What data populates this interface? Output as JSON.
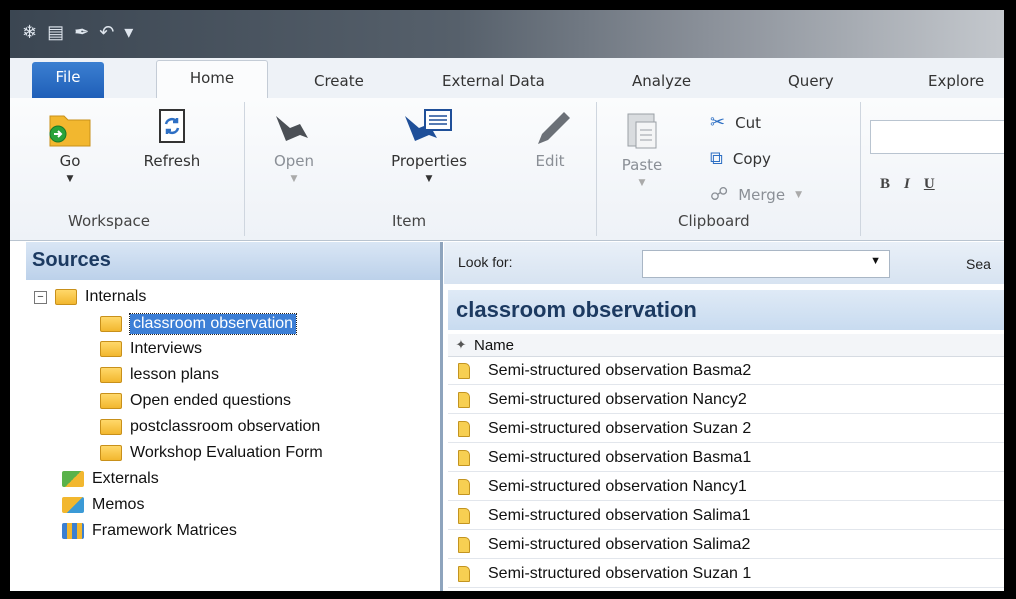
{
  "ribbon_tabs": {
    "file": "File",
    "home": "Home",
    "create": "Create",
    "external_data": "External Data",
    "analyze": "Analyze",
    "query": "Query",
    "explore": "Explore"
  },
  "workspace_group": {
    "go": "Go",
    "refresh": "Refresh",
    "label": "Workspace"
  },
  "item_group": {
    "open": "Open",
    "properties": "Properties",
    "edit": "Edit",
    "label": "Item"
  },
  "clipboard_group": {
    "paste": "Paste",
    "cut": "Cut",
    "copy": "Copy",
    "merge": "Merge",
    "label": "Clipboard"
  },
  "format": {
    "bold": "B",
    "italic": "I",
    "underline": "U"
  },
  "sources": {
    "title": "Sources",
    "internals": "Internals",
    "children": [
      "classroom observation",
      "Interviews",
      "lesson plans",
      "Open ended questions",
      "postclassroom observation",
      "Workshop Evaluation Form"
    ],
    "externals": "Externals",
    "memos": "Memos",
    "framework_matrices": "Framework Matrices"
  },
  "lookfor": {
    "label": "Look for:",
    "value": "",
    "search": "Sea"
  },
  "list": {
    "title": "classroom observation",
    "column_name": "Name",
    "rows": [
      "Semi-structured observation  Basma2",
      "Semi-structured observation  Nancy2",
      "Semi-structured observation  Suzan 2",
      "Semi-structured observation Basma1",
      "Semi-structured observation Nancy1",
      "Semi-structured observation Salima1",
      "Semi-structured observation Salima2",
      "Semi-structured observation Suzan 1"
    ]
  }
}
